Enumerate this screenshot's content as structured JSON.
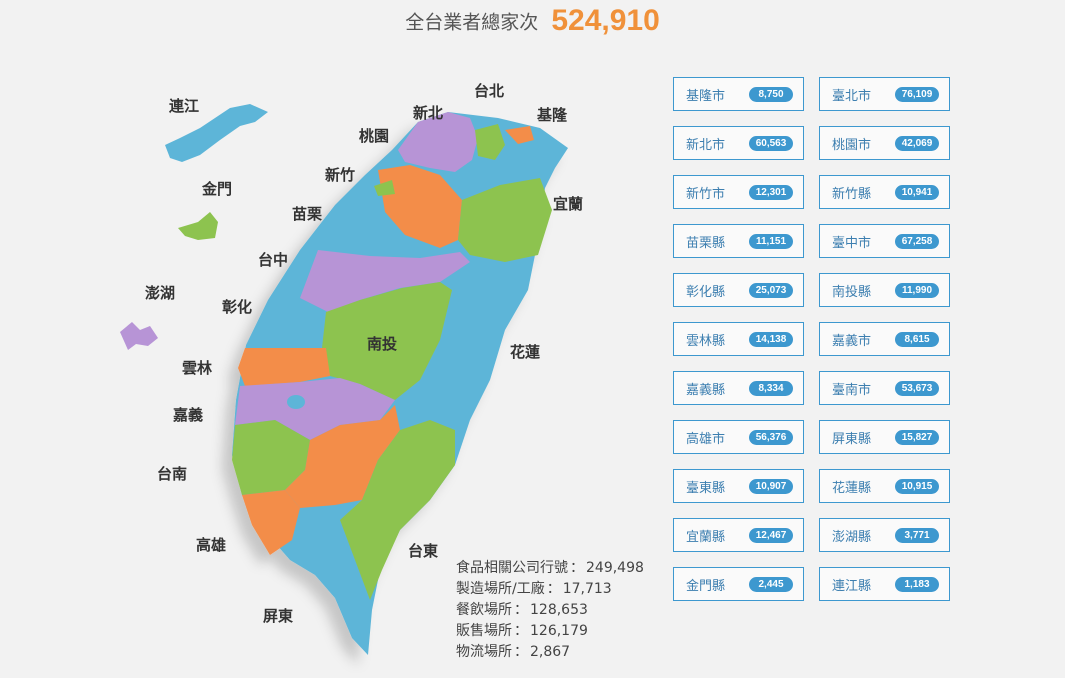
{
  "header": {
    "label": "全台業者總家次",
    "total": "524,910"
  },
  "stats": [
    {
      "label": "食品相關公司行號",
      "value": "249,498"
    },
    {
      "label": "製造場所/工廠",
      "value": "17,713"
    },
    {
      "label": "餐飲場所",
      "value": "128,653"
    },
    {
      "label": "販售場所",
      "value": "126,179"
    },
    {
      "label": "物流場所",
      "value": "2,867"
    }
  ],
  "stats_separator": "：",
  "map_labels": {
    "taipei": "台北",
    "keelung": "基隆",
    "newtaipei": "新北",
    "taoyuan": "桃園",
    "hsinchu": "新竹",
    "yilan": "宜蘭",
    "miaoli": "苗栗",
    "taichung": "台中",
    "changhua": "彰化",
    "nantou": "南投",
    "hualien": "花蓮",
    "yunlin": "雲林",
    "chiayi": "嘉義",
    "tainan": "台南",
    "kaohsiung": "高雄",
    "taitung": "台東",
    "pingtung": "屏東",
    "lienchiang": "連江",
    "kinmen": "金門",
    "penghu": "澎湖"
  },
  "colors": {
    "blue": "#5db5d8",
    "orange": "#f38d48",
    "green": "#8dc34f",
    "purple": "#b794d6",
    "accent": "#f0913a",
    "button_border": "#3d98cf"
  },
  "counties": [
    {
      "name": "基隆市",
      "count": "8,750"
    },
    {
      "name": "臺北市",
      "count": "76,109"
    },
    {
      "name": "新北市",
      "count": "60,563"
    },
    {
      "name": "桃園市",
      "count": "42,069"
    },
    {
      "name": "新竹市",
      "count": "12,301"
    },
    {
      "name": "新竹縣",
      "count": "10,941"
    },
    {
      "name": "苗栗縣",
      "count": "11,151"
    },
    {
      "name": "臺中市",
      "count": "67,258"
    },
    {
      "name": "彰化縣",
      "count": "25,073"
    },
    {
      "name": "南投縣",
      "count": "11,990"
    },
    {
      "name": "雲林縣",
      "count": "14,138"
    },
    {
      "name": "嘉義市",
      "count": "8,615"
    },
    {
      "name": "嘉義縣",
      "count": "8,334"
    },
    {
      "name": "臺南市",
      "count": "53,673"
    },
    {
      "name": "高雄市",
      "count": "56,376"
    },
    {
      "name": "屏東縣",
      "count": "15,827"
    },
    {
      "name": "臺東縣",
      "count": "10,907"
    },
    {
      "name": "花蓮縣",
      "count": "10,915"
    },
    {
      "name": "宜蘭縣",
      "count": "12,467"
    },
    {
      "name": "澎湖縣",
      "count": "3,771"
    },
    {
      "name": "金門縣",
      "count": "2,445"
    },
    {
      "name": "連江縣",
      "count": "1,183"
    }
  ]
}
